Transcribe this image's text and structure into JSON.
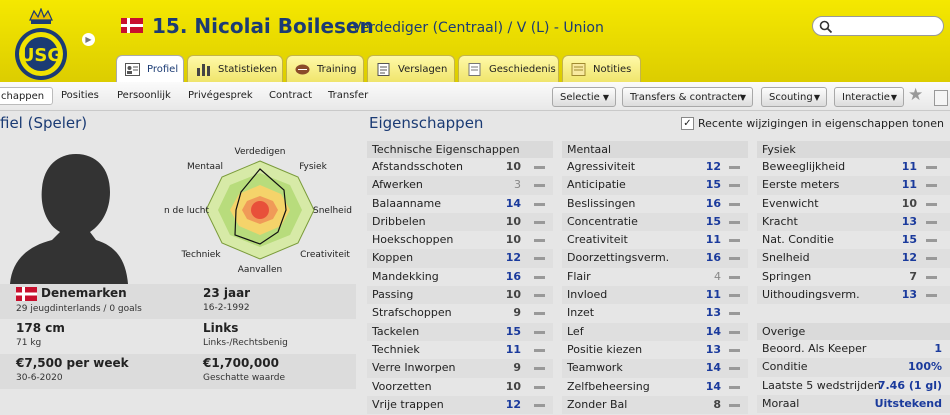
{
  "header": {
    "title": "15. Nicolai Boilesen",
    "subtitle": "Verdediger (Centraal) / V (L) - Union",
    "accent": "#f0e200",
    "brand_blue": "#1b3b74"
  },
  "tabs": [
    {
      "label": "Profiel",
      "icon": "profile-card-icon"
    },
    {
      "label": "Statistieken",
      "icon": "stats-bars-icon"
    },
    {
      "label": "Training",
      "icon": "ball-icon"
    },
    {
      "label": "Verslagen",
      "icon": "report-icon"
    },
    {
      "label": "Geschiedenis",
      "icon": "history-icon"
    },
    {
      "label": "Notities",
      "icon": "notes-icon"
    }
  ],
  "subnav": {
    "links": [
      "chappen",
      "Posities",
      "Persoonlijk",
      "Privégesprek",
      "Contract",
      "Transfer"
    ],
    "dropdowns": [
      "Selectie",
      "Transfers & contracten",
      "Scouting",
      "Interactie"
    ]
  },
  "left": {
    "title": "fiel (Speler)",
    "radar_labels": {
      "top": "Verdedigen",
      "top_left": "Mentaal",
      "top_right": "Fysiek",
      "left": "n de lucht",
      "right": "Snelheid",
      "bottom_left": "Techniek",
      "bottom_right": "Creativiteit",
      "bottom": "Aanvallen"
    }
  },
  "info": {
    "nationality": "Denemarken",
    "caps": "29 jeugdinterlands / 0 goals",
    "age": "23 jaar",
    "dob": "16-2-1992",
    "height": "178 cm",
    "weight": "71 kg",
    "foot": "Links",
    "foot_detail": "Links-/Rechtsbenig",
    "wage": "€7,500 per week",
    "contract_end": "30-6-2020",
    "value": "€1,700,000",
    "value_label": "Geschatte waarde"
  },
  "attributes": {
    "title": "Eigenschappen",
    "checkbox_label": "Recente wijzigingen in eigenschappen tonen",
    "checkbox_checked": true,
    "technical": {
      "header": "Technische Eigenschappen",
      "rows": [
        {
          "name": "Afstandsschoten",
          "value": "10"
        },
        {
          "name": "Afwerken",
          "value": "3"
        },
        {
          "name": "Balaanname",
          "value": "14"
        },
        {
          "name": "Dribbelen",
          "value": "10"
        },
        {
          "name": "Hoekschoppen",
          "value": "10"
        },
        {
          "name": "Koppen",
          "value": "12"
        },
        {
          "name": "Mandekking",
          "value": "16"
        },
        {
          "name": "Passing",
          "value": "10"
        },
        {
          "name": "Strafschoppen",
          "value": "9"
        },
        {
          "name": "Tackelen",
          "value": "15"
        },
        {
          "name": "Techniek",
          "value": "11"
        },
        {
          "name": "Verre Inworpen",
          "value": "9"
        },
        {
          "name": "Voorzetten",
          "value": "10"
        },
        {
          "name": "Vrije trappen",
          "value": "12"
        }
      ]
    },
    "mental": {
      "header": "Mentaal",
      "rows": [
        {
          "name": "Agressiviteit",
          "value": "12"
        },
        {
          "name": "Anticipatie",
          "value": "15"
        },
        {
          "name": "Beslissingen",
          "value": "16"
        },
        {
          "name": "Concentratie",
          "value": "15"
        },
        {
          "name": "Creativiteit",
          "value": "11"
        },
        {
          "name": "Doorzettingsverm.",
          "value": "16"
        },
        {
          "name": "Flair",
          "value": "4"
        },
        {
          "name": "Invloed",
          "value": "11"
        },
        {
          "name": "Inzet",
          "value": "13"
        },
        {
          "name": "Lef",
          "value": "14"
        },
        {
          "name": "Positie kiezen",
          "value": "13"
        },
        {
          "name": "Teamwork",
          "value": "14"
        },
        {
          "name": "Zelfbeheersing",
          "value": "14"
        },
        {
          "name": "Zonder Bal",
          "value": "8"
        }
      ]
    },
    "physical": {
      "header": "Fysiek",
      "rows": [
        {
          "name": "Beweeglijkheid",
          "value": "11"
        },
        {
          "name": "Eerste meters",
          "value": "11"
        },
        {
          "name": "Evenwicht",
          "value": "10"
        },
        {
          "name": "Kracht",
          "value": "13"
        },
        {
          "name": "Nat. Conditie",
          "value": "15"
        },
        {
          "name": "Snelheid",
          "value": "12"
        },
        {
          "name": "Springen",
          "value": "7"
        },
        {
          "name": "Uithoudingsverm.",
          "value": "13"
        }
      ]
    },
    "other": {
      "header": "Overige",
      "rows": [
        {
          "name": "Beoord. Als Keeper",
          "value": "1"
        },
        {
          "name": "Conditie",
          "value": "100%"
        },
        {
          "name": "Laatste 5 wedstrijden",
          "value": "7.46 (1 gl)"
        },
        {
          "name": "Moraal",
          "value": "Uitstekend"
        }
      ]
    }
  }
}
